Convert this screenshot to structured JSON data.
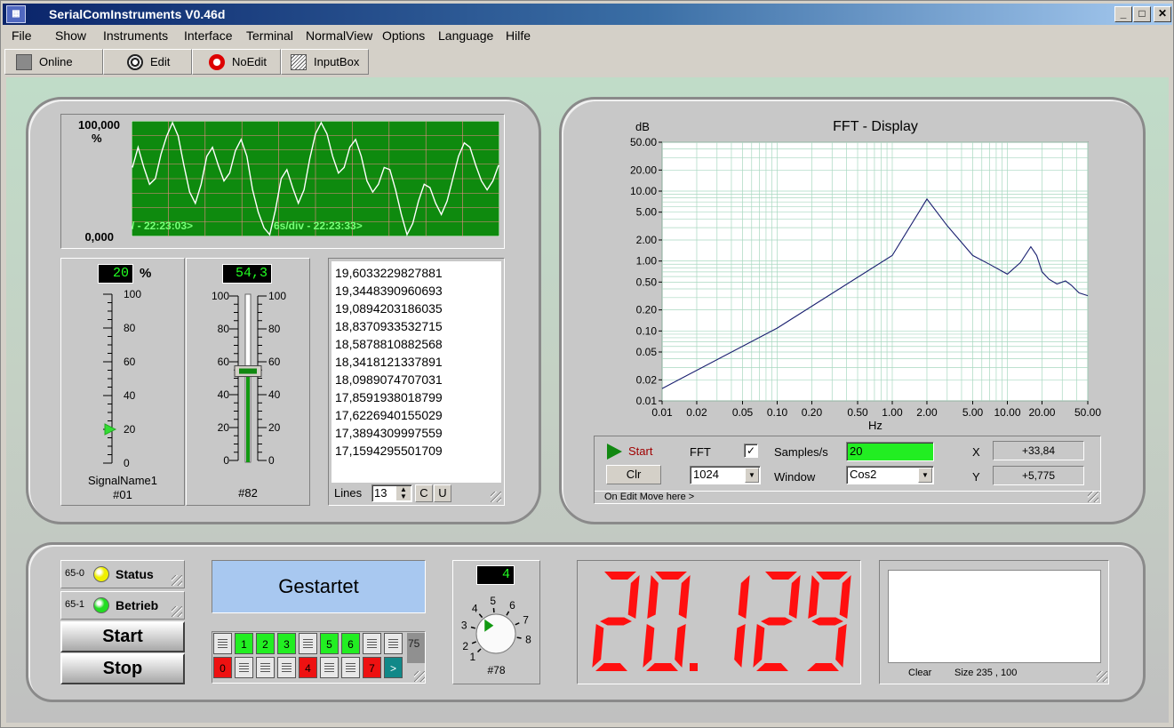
{
  "app": {
    "title": "SerialComInstruments  V0.46d"
  },
  "window_controls": {
    "minimize": "_",
    "maximize": "□",
    "close": "✕"
  },
  "menu": [
    "File",
    "Show",
    "Instruments",
    "Interface",
    "Terminal",
    "NormalView",
    "Options",
    "Language",
    "Hilfe"
  ],
  "toolbar": {
    "online": "Online",
    "edit": "Edit",
    "noedit": "NoEdit",
    "inputbox": "InputBox"
  },
  "chart_data": [
    {
      "type": "line",
      "title": "",
      "ylim": [
        0,
        100
      ],
      "y_top_label": "100,000",
      "y_unit": "%",
      "y_bottom_label": "0,000",
      "overlay_left": "/ - 22:23:03>",
      "overlay_right": "6s/div - 22:23:33>",
      "series": [
        {
          "values": [
            60,
            78,
            60,
            45,
            50,
            72,
            88,
            100,
            88,
            62,
            38,
            28,
            45,
            70,
            78,
            62,
            48,
            55,
            75,
            85,
            70,
            40,
            20,
            6,
            0,
            22,
            50,
            58,
            42,
            28,
            40,
            68,
            90,
            100,
            90,
            70,
            55,
            60,
            78,
            85,
            70,
            48,
            38,
            45,
            60,
            58,
            40,
            18,
            0,
            10,
            30,
            45,
            42,
            28,
            18,
            30,
            50,
            70,
            82,
            78,
            62,
            48,
            40,
            48,
            62
          ]
        }
      ],
      "color": "#ffffff",
      "bg": "#0e8a0e"
    },
    {
      "type": "line",
      "title": "FFT  -  Display",
      "ylabel": "dB",
      "xlabel": "Hz",
      "log_x": true,
      "log_y": true,
      "xlim": [
        0.01,
        50
      ],
      "ylim": [
        0.01,
        50
      ],
      "x_ticks": [
        "0.01",
        "0.02",
        "0.05",
        "0.10",
        "0.20",
        "0.50",
        "1.00",
        "2.00",
        "5.00",
        "10.00",
        "20.00",
        "50.00"
      ],
      "y_ticks": [
        "0.01",
        "0.02",
        "0.05",
        "0.10",
        "0.20",
        "0.50",
        "1.00",
        "2.00",
        "5.00",
        "10.00",
        "20.00",
        "50.00"
      ],
      "series": [
        {
          "x": [
            0.01,
            0.1,
            1.0,
            2.0,
            3.0,
            5.0,
            7.0,
            10.0,
            13.0,
            16.0,
            18.0,
            20.0,
            23.0,
            27.0,
            32.0,
            36.0,
            42.0,
            50.0
          ],
          "y": [
            0.015,
            0.11,
            1.2,
            7.7,
            3.2,
            1.2,
            0.9,
            0.65,
            0.95,
            1.6,
            1.2,
            0.7,
            0.55,
            0.47,
            0.52,
            0.45,
            0.35,
            0.32
          ]
        }
      ],
      "color": "#1a2070"
    }
  ],
  "gauge1": {
    "value": "20",
    "unit": "%",
    "level": 20,
    "ticks": [
      "100",
      "80",
      "60",
      "40",
      "20",
      "0"
    ],
    "name": "SignalName1",
    "id": "#01"
  },
  "gauge2": {
    "value": "54,3",
    "level": 54.3,
    "ticks_left": [
      "100",
      "80",
      "60",
      "40",
      "20",
      "0"
    ],
    "ticks_right": [
      "100",
      "80",
      "60",
      "40",
      "20",
      "0"
    ],
    "id": "#82"
  },
  "listbox": {
    "items": [
      "19,6033229827881",
      "19,3448390960693",
      "19,0894203186035",
      "18,8370933532715",
      "18,5878810882568",
      "18,3418121337891",
      "18,0989074707031",
      "17,8591938018799",
      "17,6226940155029",
      "17,3894309997559",
      "17,1594295501709"
    ],
    "lines_label": "Lines",
    "lines_value": "13",
    "btn_c": "C",
    "btn_u": "U"
  },
  "fft_controls": {
    "start": "Start",
    "clr": "Clr",
    "fft_label": "FFT",
    "fft_checked": true,
    "samples_label": "Samples/s",
    "samples_value": "20",
    "size_value": "1024",
    "window_label": "Window",
    "window_value": "Cos2",
    "x_label": "X",
    "x_value": "+33,84",
    "y_label": "Y",
    "y_value": "+5,775",
    "move_hint": "On Edit Move here >"
  },
  "status": {
    "s1_id": "65-0",
    "s1_label": "Status",
    "s1_color": "#f0f000",
    "s2_id": "65-1",
    "s2_label": "Betrieb",
    "s2_color": "#22dd22"
  },
  "buttons": {
    "start": "Start",
    "stop": "Stop"
  },
  "textdisplay": {
    "text": "Gestartet"
  },
  "switches": {
    "top": [
      {
        "l": "",
        "c": "off"
      },
      {
        "l": "1",
        "c": "g"
      },
      {
        "l": "2",
        "c": "g"
      },
      {
        "l": "3",
        "c": "g"
      },
      {
        "l": "",
        "c": "off"
      },
      {
        "l": "5",
        "c": "g"
      },
      {
        "l": "6",
        "c": "g"
      },
      {
        "l": "",
        "c": "off"
      },
      {
        "l": "",
        "c": "off"
      }
    ],
    "bottom": [
      {
        "l": "0",
        "c": "r"
      },
      {
        "l": "",
        "c": "off"
      },
      {
        "l": "",
        "c": "off"
      },
      {
        "l": "",
        "c": "off"
      },
      {
        "l": "4",
        "c": "r"
      },
      {
        "l": "",
        "c": "off"
      },
      {
        "l": "",
        "c": "off"
      },
      {
        "l": "7",
        "c": "r"
      },
      {
        "l": ">",
        "c": "t"
      }
    ],
    "value": "75"
  },
  "knob": {
    "value": "4",
    "labels": [
      "1",
      "2",
      "3",
      "4",
      "5",
      "6",
      "7",
      "8"
    ],
    "id": "#78"
  },
  "big_display": {
    "value": "20.1294",
    "color": "#ff1010"
  },
  "canvas_box": {
    "clear": "Clear",
    "size": "Size 235 , 100"
  }
}
